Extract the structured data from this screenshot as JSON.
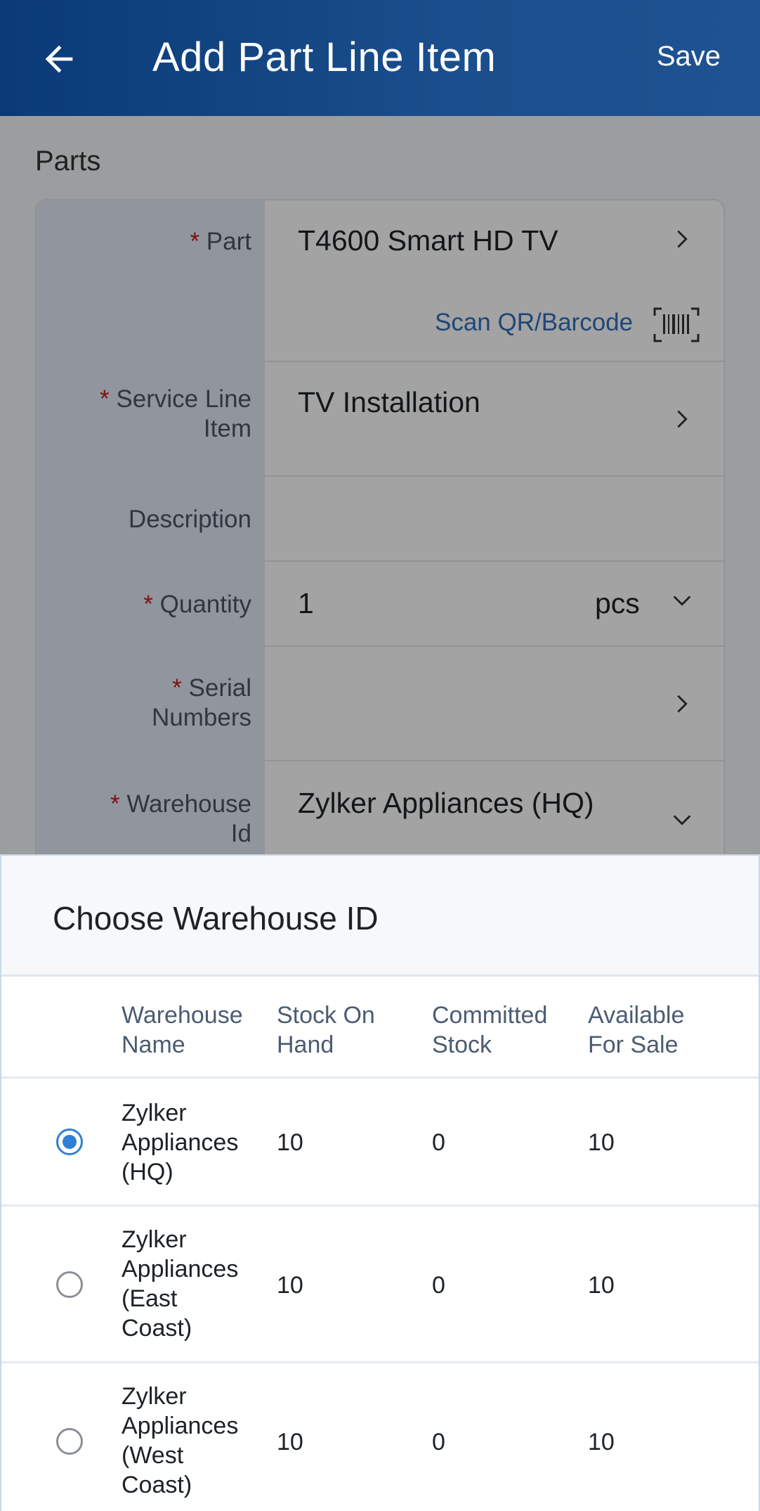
{
  "header": {
    "title": "Add Part Line Item",
    "save_label": "Save",
    "back_icon": "arrow-left-icon"
  },
  "form": {
    "section_label": "Parts",
    "part": {
      "label": "Part",
      "value": "T4600 Smart HD TV",
      "required": true
    },
    "scan": {
      "label": "Scan QR/Barcode",
      "icon": "barcode-icon"
    },
    "service_line_item": {
      "label_line1": "Service Line",
      "label_line2": "Item",
      "value": "TV Installation",
      "required": true
    },
    "description": {
      "label": "Description",
      "value": ""
    },
    "quantity": {
      "label": "Quantity",
      "value": "1",
      "unit": "pcs",
      "required": true
    },
    "serial_numbers": {
      "label_line1": "Serial",
      "label_line2": "Numbers",
      "value": "",
      "required": true
    },
    "warehouse": {
      "label_line1": "Warehouse",
      "label_line2": "Id",
      "value": "Zylker Appliances (HQ)",
      "required": true
    }
  },
  "sheet": {
    "title": "Choose Warehouse ID",
    "columns": {
      "name": [
        "Warehouse",
        "Name"
      ],
      "on_hand": [
        "Stock On",
        "Hand"
      ],
      "committed": [
        "Committed",
        "Stock"
      ],
      "available": [
        "Available",
        "For Sale"
      ]
    },
    "rows": [
      {
        "name_lines": [
          "Zylker",
          "Appliances",
          "(HQ)",
          ""
        ],
        "on_hand": "10",
        "committed": "0",
        "available": "10",
        "selected": true
      },
      {
        "name_lines": [
          "Zylker",
          "Appliances",
          "(East",
          "Coast)"
        ],
        "on_hand": "10",
        "committed": "0",
        "available": "10",
        "selected": false
      },
      {
        "name_lines": [
          "Zylker",
          "Appliances",
          "(West",
          "Coast)"
        ],
        "on_hand": "10",
        "committed": "0",
        "available": "10",
        "selected": false
      }
    ]
  },
  "colors": {
    "header_bg": "#0a3a78",
    "accent": "#2f7fd6",
    "required": "#c61c1c",
    "link": "#2f6fbf"
  }
}
